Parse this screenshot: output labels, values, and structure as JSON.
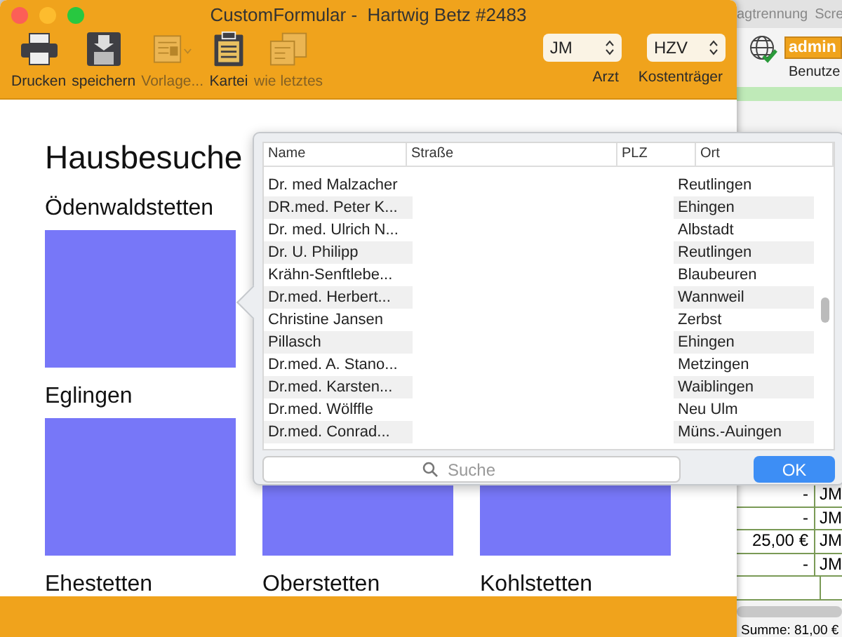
{
  "window": {
    "title": "CustomFormular -  Hartwig Betz #2483"
  },
  "toolbar": [
    {
      "kind": "printer",
      "label": "Drucken",
      "disabled": false
    },
    {
      "kind": "disk",
      "label": "speichern",
      "disabled": false
    },
    {
      "kind": "template",
      "label": "Vorlage...",
      "disabled": true
    },
    {
      "kind": "clipboard",
      "label": "Kartei",
      "disabled": false
    },
    {
      "kind": "copies",
      "label": "wie letztes",
      "disabled": true
    }
  ],
  "selectors": [
    {
      "value": "JM",
      "label": "Arzt"
    },
    {
      "value": "HZV",
      "label": "Kostenträger"
    }
  ],
  "form": {
    "heading": "Hausbesuche",
    "rows": [
      {
        "cells": [
          {
            "label": "Ödenwaldstetten",
            "tile": true
          }
        ]
      },
      {
        "cells": [
          {
            "label": "Eglingen",
            "tile": true
          },
          {
            "tile": true
          },
          {
            "tile": true
          }
        ]
      },
      {
        "cells": [
          {
            "label": "Ehestetten",
            "tile": false
          },
          {
            "label": "Oberstetten",
            "tile": false
          },
          {
            "label": "Kohlstetten",
            "tile": false
          }
        ]
      }
    ]
  },
  "picker": {
    "columns": [
      "Name",
      "Straße",
      "PLZ",
      "Ort"
    ],
    "rows": [
      {
        "name": "Dr. med Malzacher",
        "ort": "Reutlingen"
      },
      {
        "name": "DR.med. Peter K...",
        "ort": "Ehingen"
      },
      {
        "name": "Dr. med. Ulrich N...",
        "ort": "Albstadt"
      },
      {
        "name": "Dr. U. Philipp",
        "ort": "Reutlingen"
      },
      {
        "name": "Krähn-Senftlebe...",
        "ort": "Blaubeuren"
      },
      {
        "name": "Dr.med. Herbert...",
        "ort": "Wannweil"
      },
      {
        "name": "Christine Jansen",
        "ort": "Zerbst"
      },
      {
        "name": "Pillasch",
        "ort": "Ehingen"
      },
      {
        "name": "Dr.med. A. Stano...",
        "ort": "Metzingen"
      },
      {
        "name": "Dr.med. Karsten...",
        "ort": "Waiblingen"
      },
      {
        "name": "Dr.med. Wölffle",
        "ort": "Neu Ulm"
      },
      {
        "name": "Dr.med. Conrad...",
        "ort": "Müns.-Auingen"
      }
    ],
    "search": {
      "placeholder": "Suche"
    },
    "button": "OK"
  },
  "background_app": {
    "menu": [
      "agtrennung",
      "Scre"
    ],
    "user_field": {
      "value": "admin",
      "label": "Benutze"
    },
    "rows": [
      {
        "amount": "-",
        "doctor": "JM"
      },
      {
        "amount": "-",
        "doctor": "JM"
      },
      {
        "amount": "25,00 €",
        "doctor": "JM"
      },
      {
        "amount": "-",
        "doctor": "JM"
      }
    ],
    "sum": "Summe: 81,00 €"
  }
}
